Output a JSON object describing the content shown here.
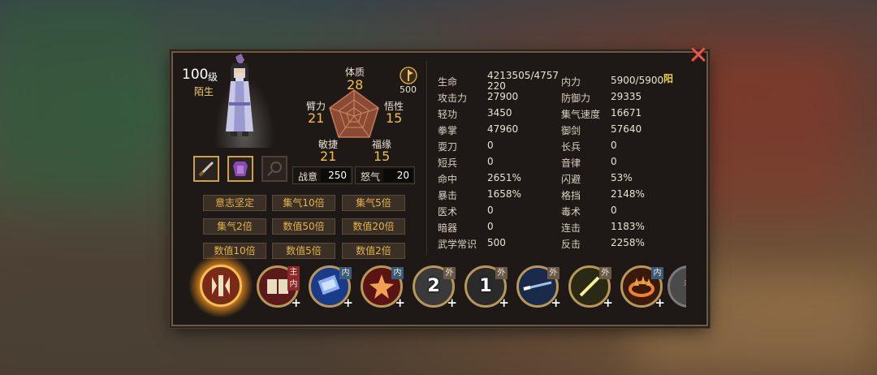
{
  "character": {
    "level": "100",
    "level_unit": "级",
    "name": "陌生"
  },
  "core_stats": {
    "tizhi": {
      "label": "体质",
      "value": "28"
    },
    "bili": {
      "label": "臂力",
      "value": "21"
    },
    "wuxing": {
      "label": "悟性",
      "value": "15"
    },
    "minjie": {
      "label": "敏捷",
      "value": "21"
    },
    "fuyuan": {
      "label": "福缘",
      "value": "15"
    }
  },
  "flag_count": "500",
  "zhanyi": {
    "label": "战意",
    "value": "250"
  },
  "nuqi": {
    "label": "怒气",
    "value": "20"
  },
  "buffs": [
    "意志坚定",
    "集气10倍",
    "集气5倍",
    "集气2倍",
    "数值50倍",
    "数值20倍",
    "数值10倍",
    "数值5倍",
    "数值2倍"
  ],
  "attributes_left": [
    {
      "label": "生命",
      "value": "4213505/4757",
      "value2": "220"
    },
    {
      "label": "攻击力",
      "value": "27900"
    },
    {
      "label": "轻功",
      "value": "3450"
    },
    {
      "label": "拳掌",
      "value": "47960"
    },
    {
      "label": "耍刀",
      "value": "0"
    },
    {
      "label": "短兵",
      "value": "0"
    },
    {
      "label": "命中",
      "value": "2651%"
    },
    {
      "label": "暴击",
      "value": "1658%"
    },
    {
      "label": "医术",
      "value": "0"
    },
    {
      "label": "暗器",
      "value": "0"
    },
    {
      "label": "武学常识",
      "value": "500"
    }
  ],
  "attributes_right": [
    {
      "label": "内力",
      "value": "5900/5900"
    },
    {
      "label": "防御力",
      "value": "29335"
    },
    {
      "label": "集气速度",
      "value": "16671"
    },
    {
      "label": "御剑",
      "value": "57640"
    },
    {
      "label": "长兵",
      "value": "0"
    },
    {
      "label": "音律",
      "value": "0"
    },
    {
      "label": "闪避",
      "value": "53%"
    },
    {
      "label": "格挡",
      "value": "2148%"
    },
    {
      "label": "毒术",
      "value": "0"
    },
    {
      "label": "连击",
      "value": "1183%"
    },
    {
      "label": "反击",
      "value": "2258%"
    }
  ],
  "neili_type": "阳",
  "skills": [
    {
      "tag": "主",
      "tag2": "内",
      "icon": "book-icon"
    },
    {
      "tag": "内",
      "icon": "scroll-icon"
    },
    {
      "tag": "内",
      "icon": "star-icon"
    },
    {
      "tag": "外",
      "number": "2",
      "icon": "fist-icon"
    },
    {
      "tag": "外",
      "number": "1",
      "icon": "claw-icon"
    },
    {
      "tag": "外",
      "icon": "sword-icon"
    },
    {
      "tag": "外",
      "icon": "blade-icon"
    },
    {
      "tag": "内",
      "icon": "fire-ring-icon"
    },
    {
      "tag": "未",
      "icon": "locked-icon"
    }
  ],
  "plus_label": "+",
  "close_label": "✕"
}
